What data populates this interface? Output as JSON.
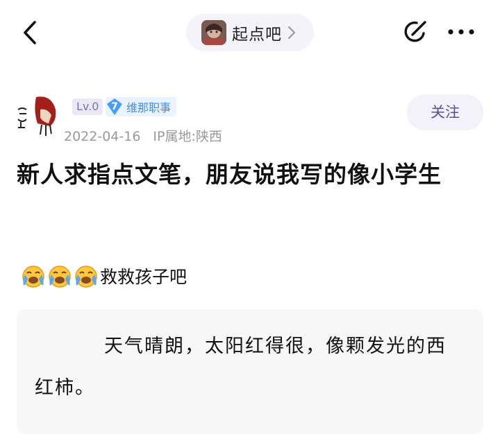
{
  "header": {
    "forum_name": "起点吧",
    "back_icon": "back-arrow-icon",
    "share_icon": "share-icon",
    "more_icon": "more-icon"
  },
  "author": {
    "level": "Lv.0",
    "role_number": "7",
    "role_title": "维那职事",
    "date": "2022-04-16",
    "ip_location": "IP属地:陕西",
    "follow_label": "关注"
  },
  "post": {
    "title": "新人求指点文笔，朋友说我写的像小学生",
    "body_text": "救救孩子吧",
    "emoji_count": 3,
    "quote_text": "天气晴朗，太阳红得很，像颗发光的西红柿。"
  },
  "colors": {
    "accent_purple": "#5a4e99",
    "role_blue": "#3a8df5",
    "meta_gray": "#999999"
  }
}
